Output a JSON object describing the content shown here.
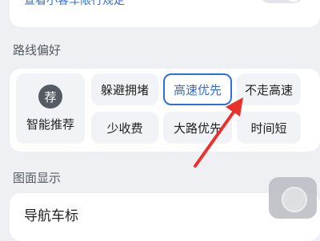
{
  "top": {
    "rule_link": "查看小客车限行规定"
  },
  "route_pref": {
    "title": "路线偏好",
    "smart": {
      "badge": "荐",
      "label": "智能推荐"
    },
    "options": [
      {
        "label": "躲避拥堵",
        "selected": false
      },
      {
        "label": "高速优先",
        "selected": true
      },
      {
        "label": "不走高速",
        "selected": false
      },
      {
        "label": "少收费",
        "selected": false
      },
      {
        "label": "大路优先",
        "selected": false
      },
      {
        "label": "时间短",
        "selected": false
      }
    ]
  },
  "display": {
    "title": "图面显示",
    "nav_icon_label": "导航车标"
  },
  "colors": {
    "accent": "#2d6fe3",
    "annotation_arrow": "#e8322b"
  }
}
